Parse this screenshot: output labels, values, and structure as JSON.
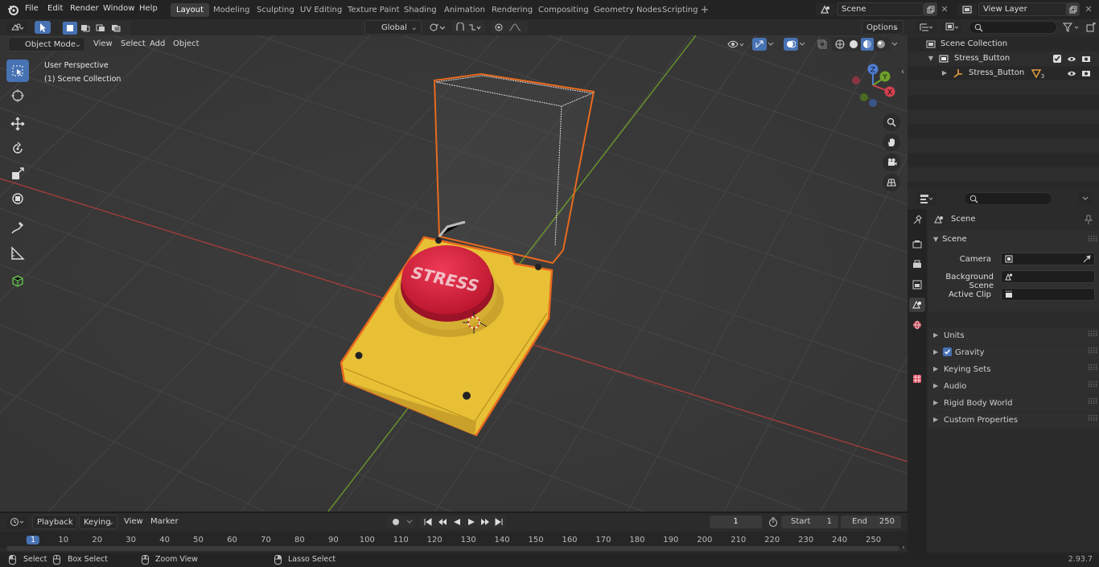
{
  "menus": [
    "File",
    "Edit",
    "Render",
    "Window",
    "Help"
  ],
  "workspaces": [
    "Layout",
    "Modeling",
    "Sculpting",
    "UV Editing",
    "Texture Paint",
    "Shading",
    "Animation",
    "Rendering",
    "Compositing",
    "Geometry Nodes",
    "Scripting"
  ],
  "active_workspace": "Layout",
  "scene_field": "Scene",
  "view_layer_field": "View Layer",
  "viewport_header": {
    "orientation": "Global",
    "options_label": "Options",
    "mode": "Object Mode",
    "menus": [
      "View",
      "Select",
      "Add",
      "Object"
    ]
  },
  "viewport": {
    "perspective_label": "User Perspective",
    "collection_label": "(1) Scene Collection",
    "gizmo_axes": {
      "x": "X",
      "y": "Y",
      "z": "Z"
    },
    "button_label_text": "STRESS"
  },
  "outliner": {
    "search_placeholder": "",
    "rows": [
      {
        "label": "Scene Collection"
      },
      {
        "label": "Stress_Button"
      },
      {
        "label": "Stress_Button",
        "badge": "3"
      }
    ]
  },
  "properties": {
    "context_title": "Scene",
    "panel_title": "Scene",
    "fields": [
      {
        "label": "Camera",
        "value": ""
      },
      {
        "label": "Background Scene",
        "value": ""
      },
      {
        "label": "Active Clip",
        "value": ""
      }
    ],
    "subpanels": [
      "Units",
      "Gravity",
      "Keying Sets",
      "Audio",
      "Rigid Body World",
      "Custom Properties"
    ],
    "gravity_checked": true
  },
  "timeline": {
    "menus": [
      "Playback",
      "Keying",
      "View",
      "Marker"
    ],
    "current_frame": "1",
    "start_label": "Start",
    "start_value": "1",
    "end_label": "End",
    "end_value": "250",
    "ruler_marks": [
      "1",
      "10",
      "20",
      "30",
      "40",
      "50",
      "60",
      "70",
      "80",
      "90",
      "100",
      "110",
      "120",
      "130",
      "140",
      "150",
      "160",
      "170",
      "180",
      "190",
      "200",
      "210",
      "220",
      "230",
      "240",
      "250"
    ]
  },
  "statusbar": {
    "items": [
      "Select",
      "Box Select",
      "Zoom View",
      "Lasso Select"
    ],
    "version": "2.93.7"
  },
  "colors": {
    "accent": "#4772b3",
    "selection_orange": "#e86a1e",
    "grid_x_axis": "#b04040",
    "grid_y_axis": "#6f9a2d",
    "button_red": "#d6213c",
    "base_yellow": "#e8c036"
  }
}
